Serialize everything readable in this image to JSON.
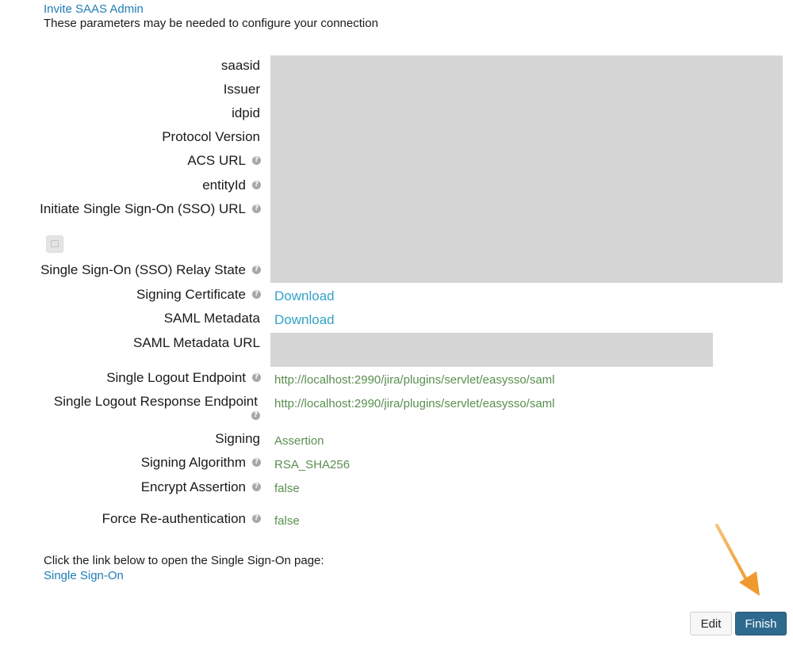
{
  "header": {
    "invite_link": "Invite SAAS Admin",
    "intro": "These parameters may be needed to configure your connection"
  },
  "fields": {
    "saasid": "saasid",
    "issuer": "Issuer",
    "idpid": "idpid",
    "protocol_version": "Protocol Version",
    "acs_url": "ACS URL",
    "entity_id": "entityId",
    "initiate_sso_url": "Initiate Single Sign-On (SSO) URL",
    "sso_relay_state": "Single Sign-On (SSO) Relay State",
    "signing_certificate": "Signing Certificate",
    "saml_metadata": "SAML Metadata",
    "saml_metadata_url": "SAML Metadata URL",
    "single_logout_endpoint": "Single Logout Endpoint",
    "single_logout_response_endpoint": "Single Logout Response Endpoint",
    "signing": "Signing",
    "signing_algorithm": "Signing Algorithm",
    "encrypt_assertion": "Encrypt Assertion",
    "force_reauth": "Force Re-authentication"
  },
  "values": {
    "signing_certificate_link": "Download",
    "saml_metadata_link": "Download",
    "single_logout_endpoint": "http://localhost:2990/jira/plugins/servlet/easysso/saml",
    "single_logout_response_endpoint": "http://localhost:2990/jira/plugins/servlet/easysso/saml",
    "signing": "Assertion",
    "signing_algorithm": "RSA_SHA256",
    "encrypt_assertion": "false",
    "force_reauth": "false"
  },
  "footer": {
    "instruction": "Click the link below to open the Single Sign-On page:",
    "sso_link": "Single Sign-On"
  },
  "buttons": {
    "edit": "Edit",
    "finish": "Finish"
  },
  "help_glyph": "?",
  "colors": {
    "link": "#1f7db5",
    "download_link": "#33a3c9",
    "value_green": "#5a8f4f",
    "redacted": "#d6d6d6",
    "finish_button": "#2e6a8e",
    "arrow": "#f0a23a"
  }
}
